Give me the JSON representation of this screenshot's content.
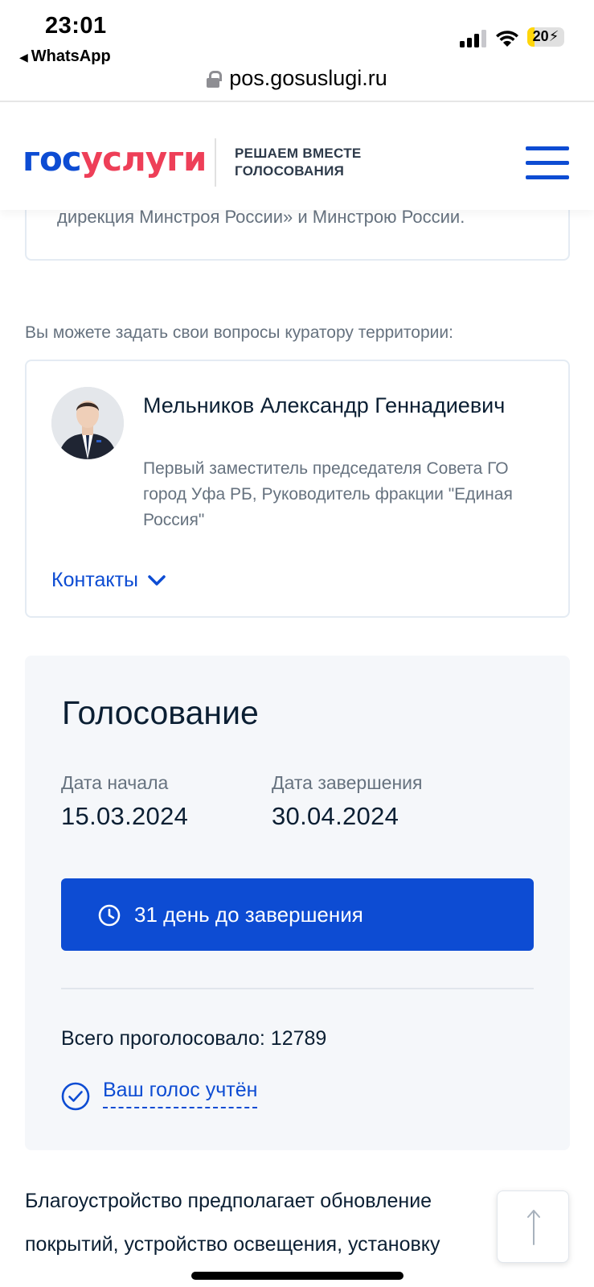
{
  "status_bar": {
    "time": "23:01",
    "back_app": "WhatsApp",
    "battery": "20",
    "battery_level": 0.2
  },
  "browser": {
    "url": "pos.gosuslugi.ru"
  },
  "header": {
    "logo_part1": "гос",
    "logo_part2": "услуги",
    "tagline_line1": "РЕШАЕМ ВМЕСТЕ",
    "tagline_line2": "ГОЛОСОВАНИЯ",
    "menu_icon": "hamburger-icon",
    "brand_blue": "#0d4cd3",
    "brand_red": "#ee3f58"
  },
  "previous_card": {
    "text": "дирекция Минстроя России» и Минстрою России."
  },
  "curator": {
    "caption": "Вы можете задать свои вопросы куратору территории:",
    "name": "Мельников Александр Геннадиевич",
    "role": "Первый заместитель председателя Совета ГО город Уфа РБ, Руководитель фракции \"Единая Россия\"",
    "contacts_label": "Контакты"
  },
  "voting": {
    "title": "Голосование",
    "start_label": "Дата начала",
    "start_date": "15.03.2024",
    "end_label": "Дата завершения",
    "end_date": "30.04.2024",
    "days_left": "31 день до завершения",
    "total_votes": "Всего проголосовало: 12789",
    "voted_label": "Ваш голос учтён"
  },
  "description": {
    "text": "Благоустройство предполагает обновление покрытий, устройство освещения, установку"
  }
}
